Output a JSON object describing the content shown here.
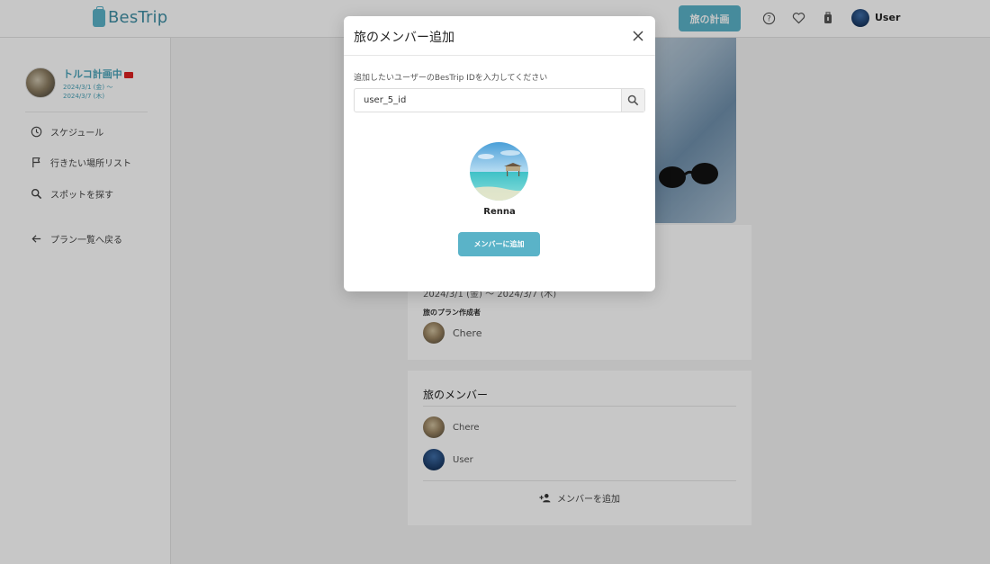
{
  "header": {
    "logo_text": "BesTrip",
    "plan_button": "旅の計画",
    "user_name": "User"
  },
  "sidebar": {
    "trip_title": "トルコ計画中",
    "date_start": "2024/3/1 (金) 〜",
    "date_end": "2024/3/7 (木)",
    "items": [
      {
        "label": "スケジュール",
        "icon": "clock-icon"
      },
      {
        "label": "行きたい場所リスト",
        "icon": "flag-icon"
      },
      {
        "label": "スポットを探す",
        "icon": "search-icon"
      },
      {
        "label": "プラン一覧へ戻る",
        "icon": "arrow-left-icon"
      }
    ]
  },
  "main": {
    "trip_dates": "2024/3/1 (金) 〜 2024/3/7 (木)",
    "creator_label": "旅のプラン作成者",
    "creator_name": "Chere",
    "members_title": "旅のメンバー",
    "members": [
      {
        "name": "Chere"
      },
      {
        "name": "User"
      }
    ],
    "add_member_label": "メンバーを追加"
  },
  "modal": {
    "title": "旅のメンバー追加",
    "instruction": "追加したいユーザーのBesTrip IDを入力してください",
    "search_value": "user_5_id",
    "result_name": "Renna",
    "add_button": "メンバーに追加"
  },
  "colors": {
    "accent": "#5ab3c8",
    "accent_text": "#4aa3b9"
  }
}
